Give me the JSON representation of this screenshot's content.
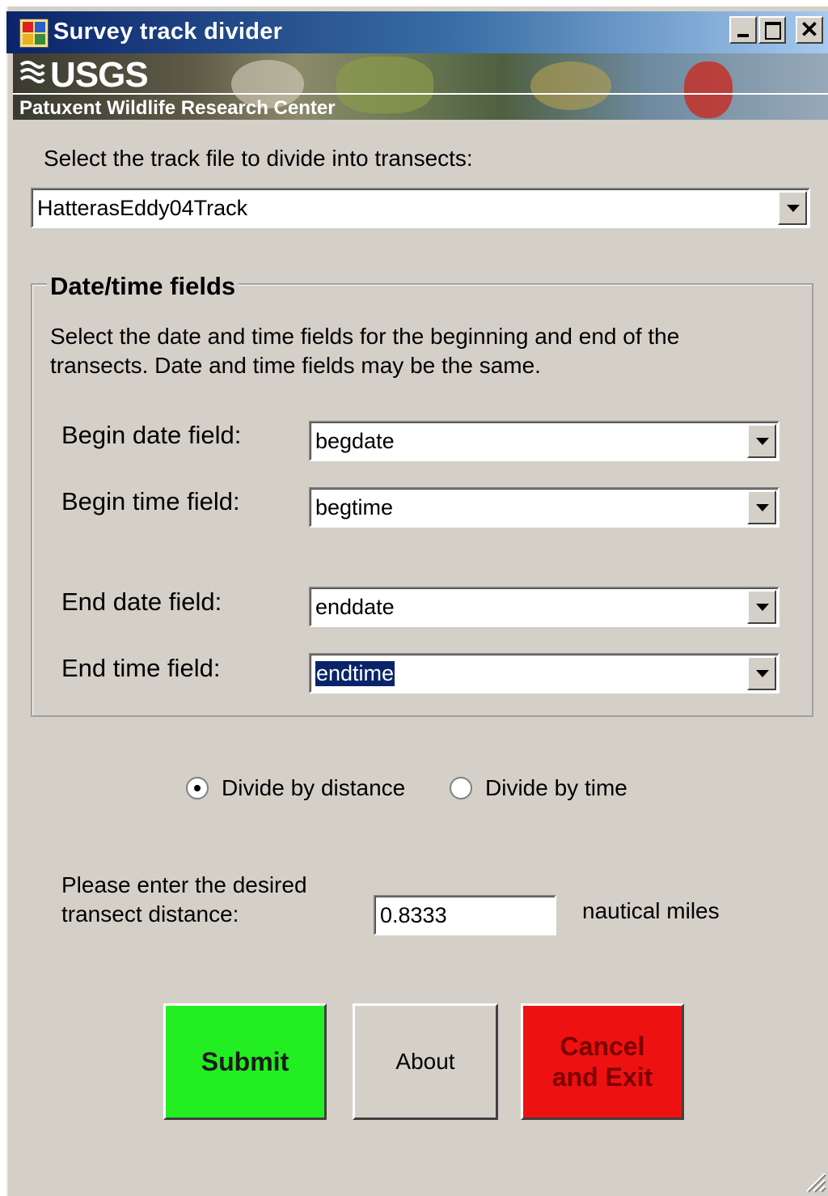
{
  "window": {
    "title": "Survey track divider"
  },
  "banner": {
    "agency": "USGS",
    "center": "Patuxent Wildlife Research Center"
  },
  "track": {
    "label": "Select the track file to divide into transects:",
    "selected": "HatterasEddy04Track"
  },
  "datetime_group": {
    "title": "Date/time fields",
    "instructions_line1": "Select the date and time fields for the beginning and end of the",
    "instructions_line2": "transects.  Date and time fields may be the same.",
    "begin_date_label": "Begin date field:",
    "begin_date_value": "begdate",
    "begin_time_label": "Begin time field:",
    "begin_time_value": "begtime",
    "end_date_label": "End date field:",
    "end_date_value": "enddate",
    "end_time_label": "End time field:",
    "end_time_value": "endtime"
  },
  "divide_mode": {
    "distance_label": "Divide by distance",
    "time_label": "Divide by time",
    "selected": "distance"
  },
  "distance": {
    "prompt_line1": "Please enter the desired",
    "prompt_line2": "transect distance:",
    "value": "0.8333",
    "unit": "nautical miles"
  },
  "buttons": {
    "submit": "Submit",
    "about": "About",
    "cancel_line1": "Cancel",
    "cancel_line2": "and Exit"
  },
  "colors": {
    "submit_bg": "#22ee22",
    "cancel_bg": "#ee1111",
    "window_bg": "#d4d0c8",
    "titlebar_start": "#0a246a"
  }
}
